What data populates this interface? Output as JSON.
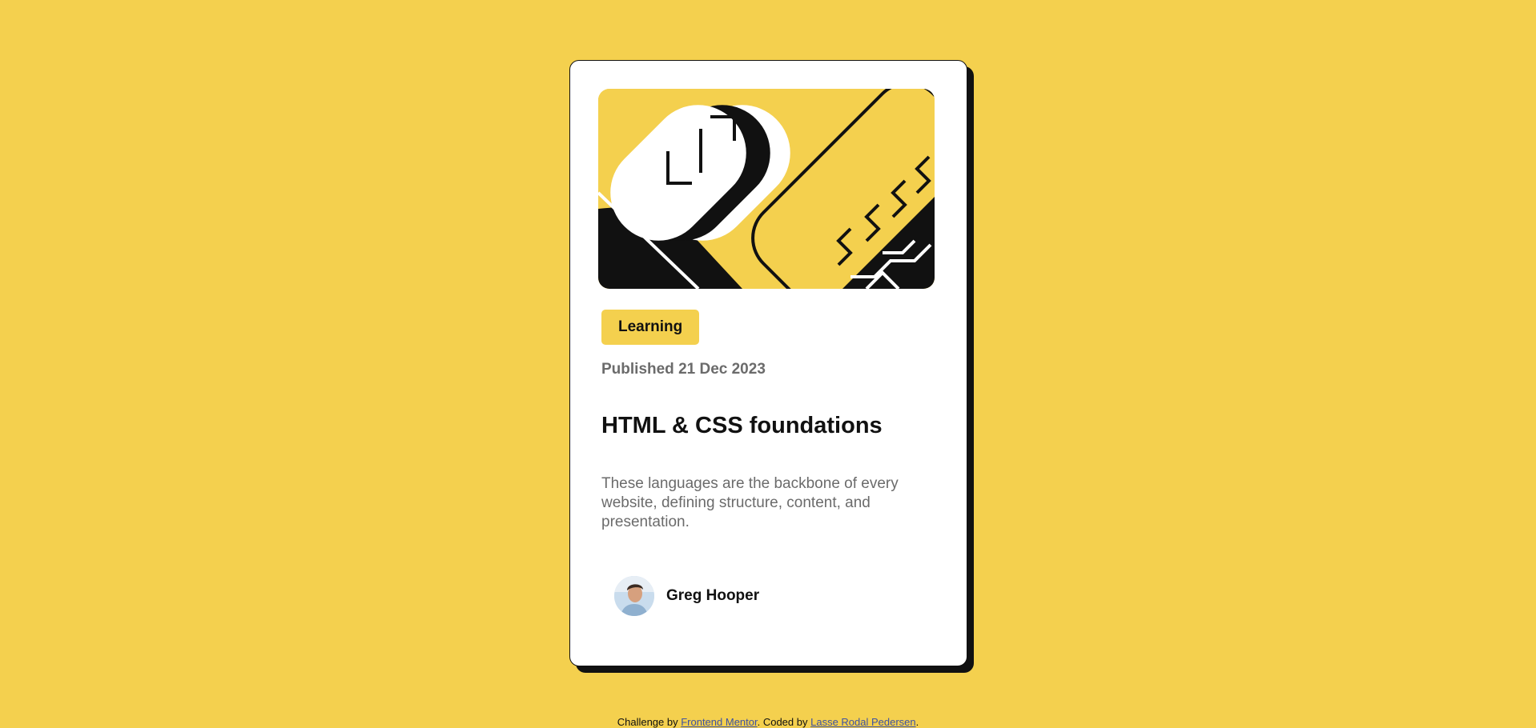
{
  "card": {
    "image_alt": "HTML & CSS illustration",
    "category": "Learning",
    "published": "Published 21 Dec 2023",
    "title": "HTML & CSS foundations",
    "description": "These languages are the backbone of every website, defining structure, content, and presentation.",
    "author": {
      "name": "Greg Hooper"
    }
  },
  "footer": {
    "prefix": "Challenge by ",
    "link1": "Frontend Mentor",
    "middle": ". Coded by ",
    "link2": "Lasse Rodal Pedersen",
    "suffix": "."
  },
  "colors": {
    "background": "#f4d04e",
    "card": "#ffffff",
    "ink": "#111111",
    "muted": "#6b6b6b"
  }
}
